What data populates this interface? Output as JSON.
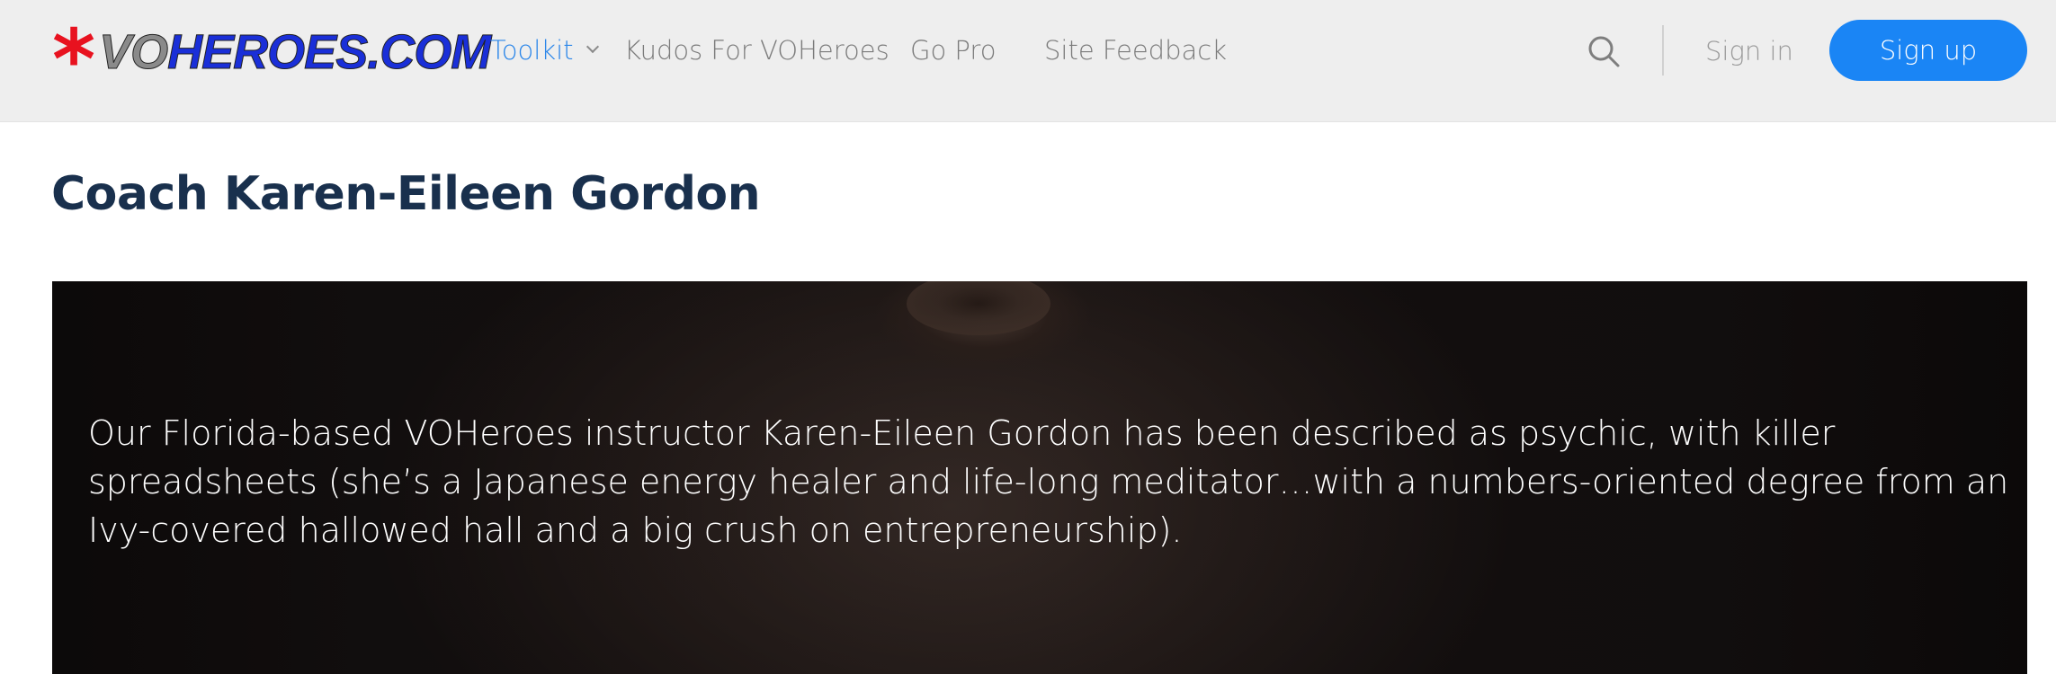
{
  "header": {
    "logo": {
      "star": "*",
      "part1": "VO",
      "part2": "HEROES.COM",
      "colors": {
        "star": "#e8121f",
        "vo": "#8a8a8a",
        "heroes": "#1a2fd8"
      }
    },
    "nav": [
      {
        "label": "Toolkit",
        "active": true,
        "has_dropdown": true
      },
      {
        "label": "Kudos For VOHeroes"
      },
      {
        "label": "Go Pro"
      },
      {
        "label": "Site Feedback"
      }
    ],
    "search_icon": "search-icon",
    "signin_label": "Sign in",
    "signup_label": "Sign up"
  },
  "main": {
    "title": "Coach Karen-Eileen Gordon",
    "hero": {
      "text": "Our Florida-based VOHeroes instructor Karen-Eileen Gordon has been described as psychic, with killer spreadsheets (she’s a Japanese energy healer and life-long meditator…with a numbers-oriented degree from an Ivy-covered hallowed hall and a big crush on entrepreneurship)."
    }
  },
  "colors": {
    "accent": "#2b86e9",
    "signup_bg": "#1a85f5",
    "title": "#19304d",
    "topbar_bg": "#eeeeee"
  }
}
